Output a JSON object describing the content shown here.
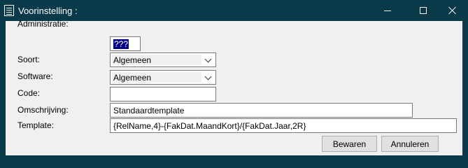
{
  "window": {
    "title": "Voorinstelling :"
  },
  "form": {
    "administratie": {
      "label": "Administratie:",
      "value": "???"
    },
    "soort": {
      "label": "Soort:",
      "value": "Algemeen"
    },
    "software": {
      "label": "Software:",
      "value": "Algemeen"
    },
    "code": {
      "label": "Code:",
      "value": ""
    },
    "omschrijving": {
      "label": "Omschrijving:",
      "value": "Standaardtemplate"
    },
    "template": {
      "label": "Template:",
      "value": "{RelName,4}-{FakDat.MaandKort}/{FakDat.Jaar,2R}"
    }
  },
  "buttons": {
    "save": "Bewaren",
    "cancel": "Annuleren"
  },
  "colors": {
    "titlebar": "#0a3a4a",
    "client": "#f0f0f0",
    "selection": "#000080"
  }
}
